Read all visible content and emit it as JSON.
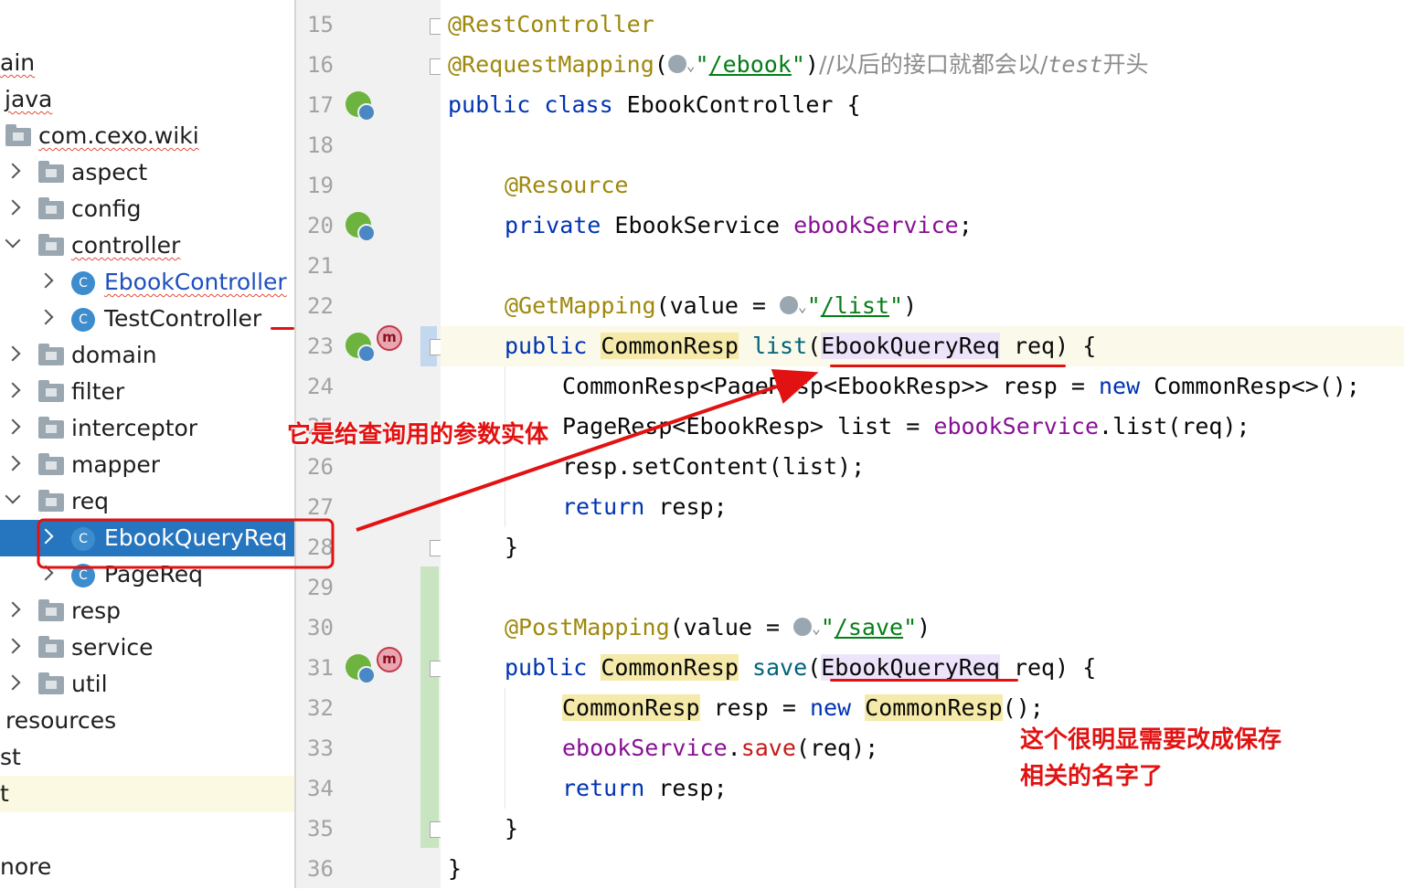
{
  "project_tree": {
    "items": [
      {
        "label": "ain",
        "kind": "text",
        "squiggle": true
      },
      {
        "label": "java",
        "kind": "text",
        "squiggle": true
      },
      {
        "label": "com.cexo.wiki",
        "kind": "folder",
        "squiggle": true
      },
      {
        "label": "aspect",
        "kind": "folder"
      },
      {
        "label": "config",
        "kind": "folder"
      },
      {
        "label": "controller",
        "kind": "folder",
        "squiggle": true
      },
      {
        "label": "EbookController",
        "kind": "class",
        "squiggle": true
      },
      {
        "label": "TestController",
        "kind": "class"
      },
      {
        "label": "domain",
        "kind": "folder"
      },
      {
        "label": "filter",
        "kind": "folder"
      },
      {
        "label": "interceptor",
        "kind": "folder"
      },
      {
        "label": "mapper",
        "kind": "folder"
      },
      {
        "label": "req",
        "kind": "folder"
      },
      {
        "label": "EbookQueryReq",
        "kind": "class",
        "selected": true
      },
      {
        "label": "PageReq",
        "kind": "class"
      },
      {
        "label": "resp",
        "kind": "folder"
      },
      {
        "label": "service",
        "kind": "folder"
      },
      {
        "label": "util",
        "kind": "folder"
      },
      {
        "label": "resources",
        "kind": "text"
      },
      {
        "label": "st",
        "kind": "text"
      },
      {
        "label": "t",
        "kind": "text",
        "highlighted": true
      },
      {
        "label": "",
        "kind": "text"
      },
      {
        "label": "nore",
        "kind": "text"
      }
    ],
    "class_icon_letter": "C"
  },
  "gutter": {
    "line_numbers": [
      "15",
      "16",
      "17",
      "18",
      "19",
      "20",
      "21",
      "22",
      "23",
      "24",
      "25",
      "26",
      "27",
      "28",
      "29",
      "30",
      "31",
      "32",
      "33",
      "34",
      "35",
      "36"
    ],
    "method_badge": "m",
    "icons": [
      "spring-controller-icon",
      "spring-bean-icon",
      "request-mapping-icon"
    ]
  },
  "code": {
    "l15_ann": "@RestController",
    "l16_ann": "@RequestMapping",
    "l16_open": "(",
    "l16_q1": "\"",
    "l16_url": "/ebook",
    "l16_q2": "\"",
    "l16_close": ")",
    "l16_cmt_a": "//以后的接口就都会以/",
    "l16_cmt_b": "test",
    "l16_cmt_c": "开头",
    "l17_kw": "public class ",
    "l17_rest": "EbookController {",
    "l19_ann": "@Resource",
    "l20_kw": "private ",
    "l20_type": "EbookService ",
    "l20_field": "ebookService",
    "l20_end": ";",
    "l22_ann": "@GetMapping",
    "l22_mid": "(value = ",
    "l22_q1": "\"",
    "l22_url": "/list",
    "l22_q2": "\"",
    "l22_end": ")",
    "l23_kw": "public ",
    "l23_type": "CommonResp",
    "l23_sp": " ",
    "l23_method": "list",
    "l23_open": "(",
    "l23_param": "EbookQueryReq",
    "l23_end": " req) {",
    "l24_text": "CommonResp<PageResp<EbookResp>> resp = ",
    "l24_kw": "new",
    "l24_end": " CommonResp<>();",
    "l25_text": "PageResp<EbookResp> list = ",
    "l25_field": "ebookService",
    "l25_end": ".list(req);",
    "l26_text": "resp.setContent(list);",
    "l27_kw": "return",
    "l27_end": " resp;",
    "l28_text": "}",
    "l30_ann": "@PostMapping",
    "l30_mid": "(value = ",
    "l30_q1": "\"",
    "l30_url": "/save",
    "l30_q2": "\"",
    "l30_end": ")",
    "l31_kw": "public ",
    "l31_type": "CommonResp",
    "l31_sp": " ",
    "l31_method": "save",
    "l31_open": "(",
    "l31_param": "EbookQueryReq",
    "l31_end": " req) {",
    "l32_type": "CommonResp",
    "l32_mid": " resp = ",
    "l32_kw": "new",
    "l32_sp": " ",
    "l32_type2": "CommonResp",
    "l32_end": "();",
    "l33_field": "ebookService",
    "l33_dot": ".",
    "l33_method": "save",
    "l33_end": "(req);",
    "l34_kw": "return",
    "l34_end": " resp;",
    "l35_text": "}",
    "l36_text": "}",
    "caret_glyph": "⌄"
  },
  "annotations": {
    "note1": "它是给查询用的参数实体",
    "note2": "这个很明显需要改成保存相关的名字了",
    "color": "#e21212"
  }
}
